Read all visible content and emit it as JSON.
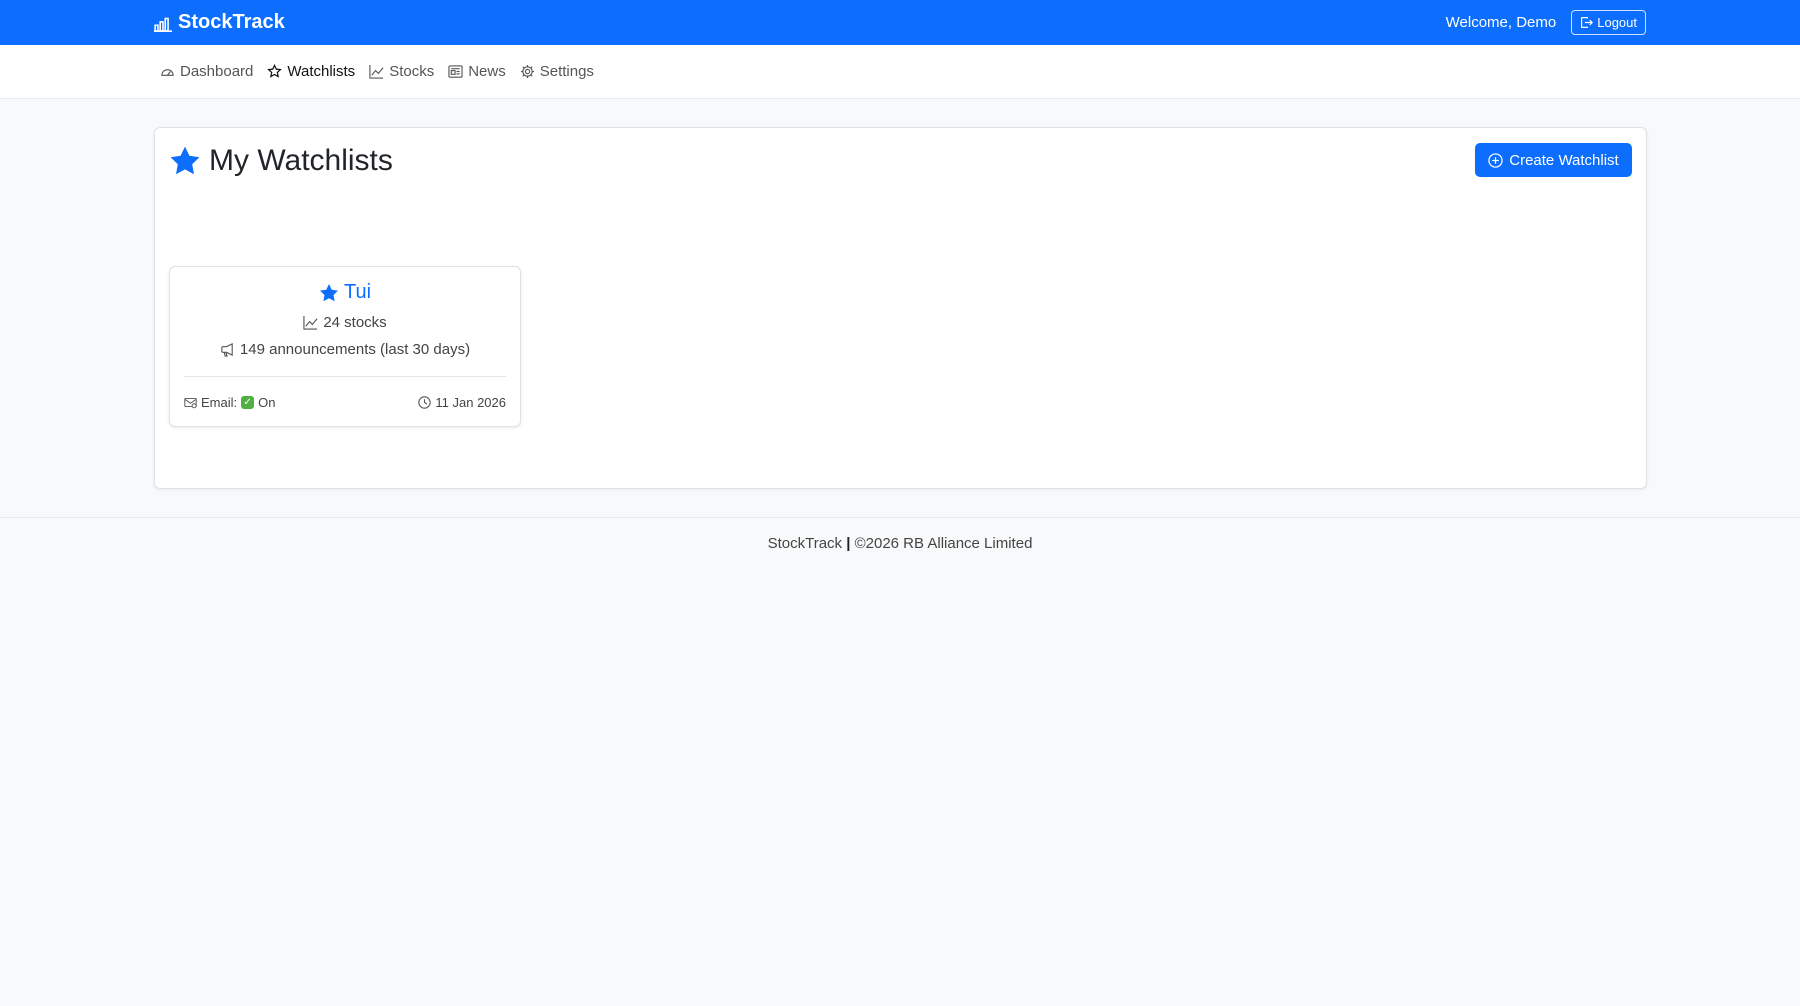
{
  "header": {
    "brand": "StockTrack",
    "welcome": "Welcome, Demo",
    "logout_label": "Logout"
  },
  "nav": {
    "items": [
      {
        "label": "Dashboard",
        "icon": "speedometer-icon"
      },
      {
        "label": "Watchlists",
        "icon": "star-outline-icon"
      },
      {
        "label": "Stocks",
        "icon": "graph-up-icon"
      },
      {
        "label": "News",
        "icon": "newspaper-icon"
      },
      {
        "label": "Settings",
        "icon": "gear-icon"
      }
    ],
    "active": "Watchlists"
  },
  "main": {
    "title": "My Watchlists",
    "create_label": "Create Watchlist",
    "watchlists": [
      {
        "name": "Tui",
        "stocks": "24 stocks",
        "announcements": "149 announcements (last 30 days)",
        "email_label": "Email:",
        "email_status": "On",
        "date": "11 Jan 2026"
      }
    ]
  },
  "footer": {
    "brand": "StockTrack",
    "separator": "|",
    "copyright": "©2026 RB Alliance Limited"
  },
  "colors": {
    "primary": "#0d6efd",
    "background": "#f8f9fa",
    "check": "#52b043"
  }
}
